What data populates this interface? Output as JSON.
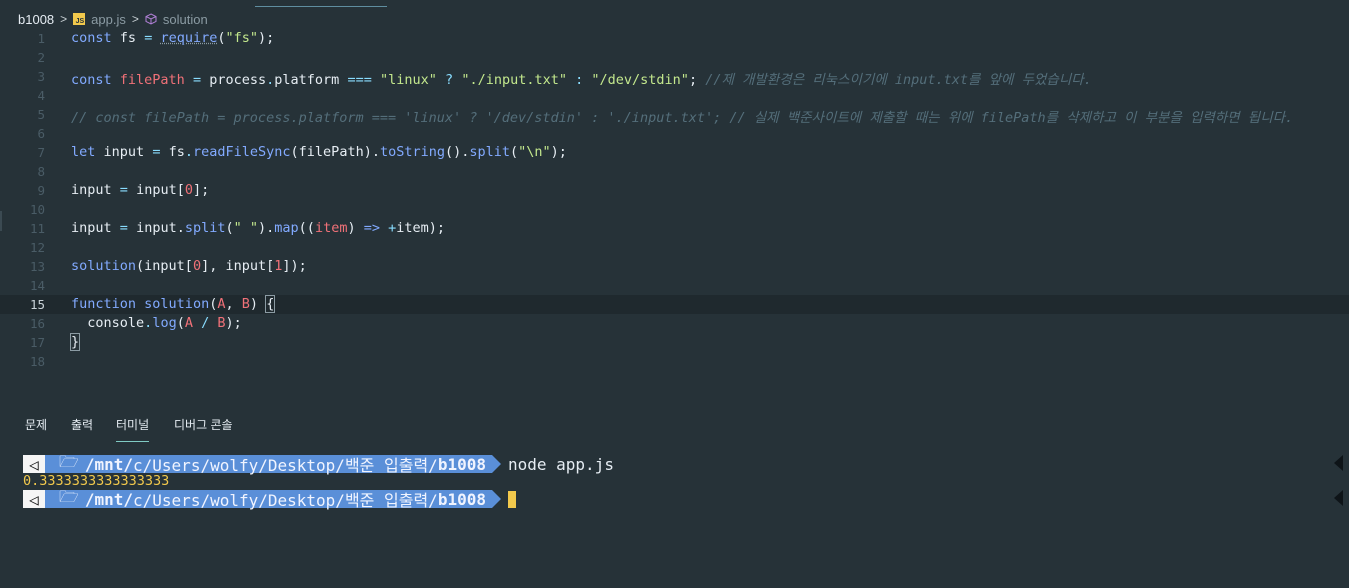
{
  "breadcrumb": {
    "folder": "b1008",
    "file": "app.js",
    "js_badge": "JS",
    "symbol": "solution"
  },
  "editor": {
    "current_line": 15,
    "lines": [
      {
        "n": "1"
      },
      {
        "n": "2"
      },
      {
        "n": "3"
      },
      {
        "n": "4"
      },
      {
        "n": "5"
      },
      {
        "n": "6"
      },
      {
        "n": "7"
      },
      {
        "n": "8"
      },
      {
        "n": "9"
      },
      {
        "n": "10"
      },
      {
        "n": "11"
      },
      {
        "n": "12"
      },
      {
        "n": "13"
      },
      {
        "n": "14"
      },
      {
        "n": "15"
      },
      {
        "n": "16"
      },
      {
        "n": "17"
      },
      {
        "n": "18"
      }
    ],
    "code": {
      "l1": [
        "const",
        "fs",
        "=",
        "require",
        "(",
        "\"fs\"",
        ");"
      ],
      "l3": [
        "const",
        "filePath",
        "=",
        "process",
        ".",
        "platform",
        "===",
        "\"linux\"",
        "?",
        "\"./input.txt\"",
        ":",
        "\"/dev/stdin\"",
        ";",
        "//제 개발환경은 리눅스이기에 input.txt를 앞에 두었습니다."
      ],
      "l5": "// const filePath = process.platform === 'linux' ? '/dev/stdin' : './input.txt'; // 실제 백준사이트에 제출할 때는 위에 filePath를 삭제하고 이 부분을 입력하면 됩니다.",
      "l7": [
        "let",
        "input",
        "=",
        "fs",
        ".",
        "readFileSync",
        "(filePath).",
        "toString",
        "().",
        "split",
        "(",
        "\"\\n\"",
        ");"
      ],
      "l9": [
        "input",
        "=",
        "input[",
        "0",
        "];"
      ],
      "l11": [
        "input",
        "=",
        "input.",
        "split",
        "(",
        "\" \"",
        ").",
        "map",
        "((",
        "item",
        ")",
        "=>",
        "+",
        "item);"
      ],
      "l13": [
        "solution",
        "(input[",
        "0",
        "], input[",
        "1",
        "]);"
      ],
      "l15": [
        "function",
        "solution",
        "(",
        "A",
        ",",
        "B",
        ")",
        "{"
      ],
      "l16": [
        "console",
        ".",
        "log",
        "(",
        "A",
        "/",
        "B",
        ");"
      ],
      "l17": "}"
    }
  },
  "panel": {
    "tabs": [
      "문제",
      "출력",
      "터미널",
      "디버그 콘솔"
    ],
    "active_tab": "터미널"
  },
  "terminal": {
    "prompt_icon": "◁",
    "folder_icon": "🗁",
    "path_prefix": "/mnt/",
    "path_mid": "c/Users/wolfy/Desktop/백준 입출력/",
    "path_dir": "b1008",
    "command": "node app.js",
    "output": "0.3333333333333333"
  },
  "colors": {
    "background": "#263238",
    "keyword": "#82aaff",
    "string": "#c3e88d",
    "number": "#f07178",
    "comment": "#546e7a",
    "prompt_blue": "#5a8fd8",
    "output_yellow": "#f2c94c"
  }
}
